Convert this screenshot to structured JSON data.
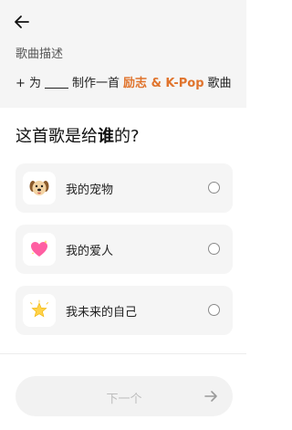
{
  "header": {
    "description_label": "歌曲描述",
    "prompt": {
      "prefix": "+ 为",
      "middle": "制作一首",
      "accent": "励志 & K-Pop",
      "suffix": "歌曲"
    }
  },
  "question": {
    "part1": "这首歌是给",
    "emphasis": "谁",
    "part2": "的?"
  },
  "options": [
    {
      "label": "我的宠物",
      "icon": "dog-face-icon",
      "selected": false
    },
    {
      "label": "我的爱人",
      "icon": "sparkling-heart-icon",
      "selected": false
    },
    {
      "label": "我未来的自己",
      "icon": "glowing-star-icon",
      "selected": false
    }
  ],
  "footer": {
    "next_label": "下一个"
  },
  "colors": {
    "accent": "#e0742d",
    "card_bg": "#f5f5f5",
    "disabled_text": "#bdbdbd"
  }
}
